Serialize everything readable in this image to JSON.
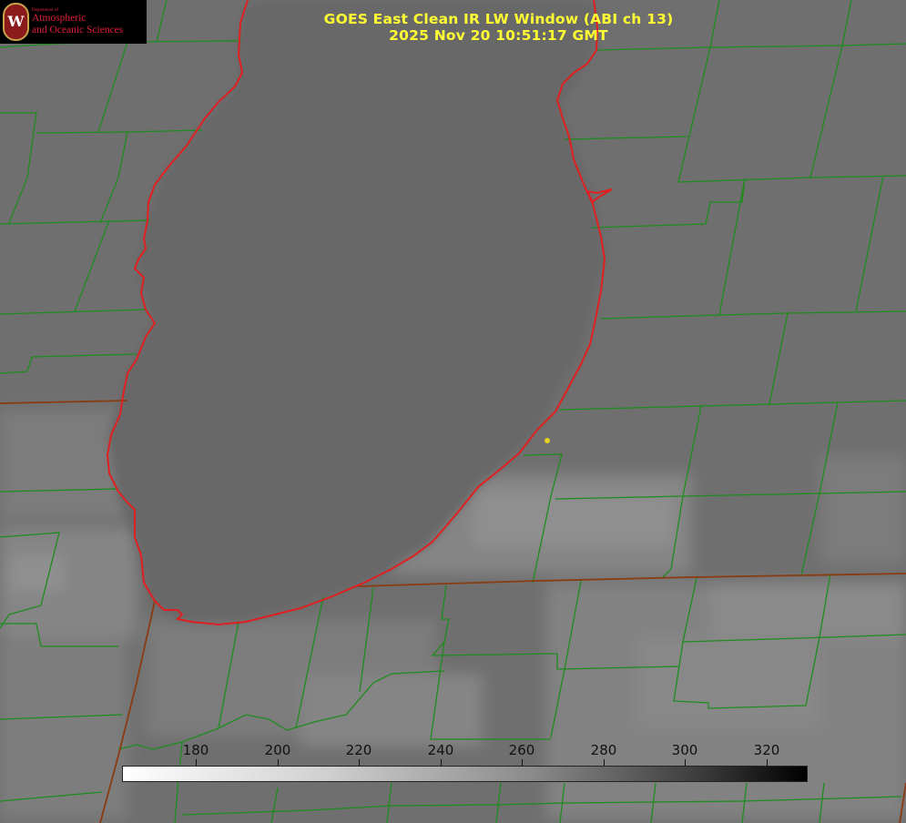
{
  "title": {
    "line1": "GOES East Clean IR LW Window (ABI ch 13)",
    "line2": "2025 Nov 20 10:51:17 GMT"
  },
  "logo": {
    "department": "Department of",
    "line1": "Atmospheric",
    "line2": "and Oceanic Sciences",
    "seal_letter": "W"
  },
  "colorbar": {
    "ticks": [
      "180",
      "200",
      "220",
      "240",
      "260",
      "280",
      "300",
      "320"
    ],
    "min_color": "#ffffff",
    "max_color": "#000000"
  },
  "colors": {
    "county_lines": "#1e8c1e",
    "shoreline": "#e02020",
    "state_lines": "#8a3b10",
    "title_text": "#ffff33",
    "station_marker": "#e6d21e"
  }
}
